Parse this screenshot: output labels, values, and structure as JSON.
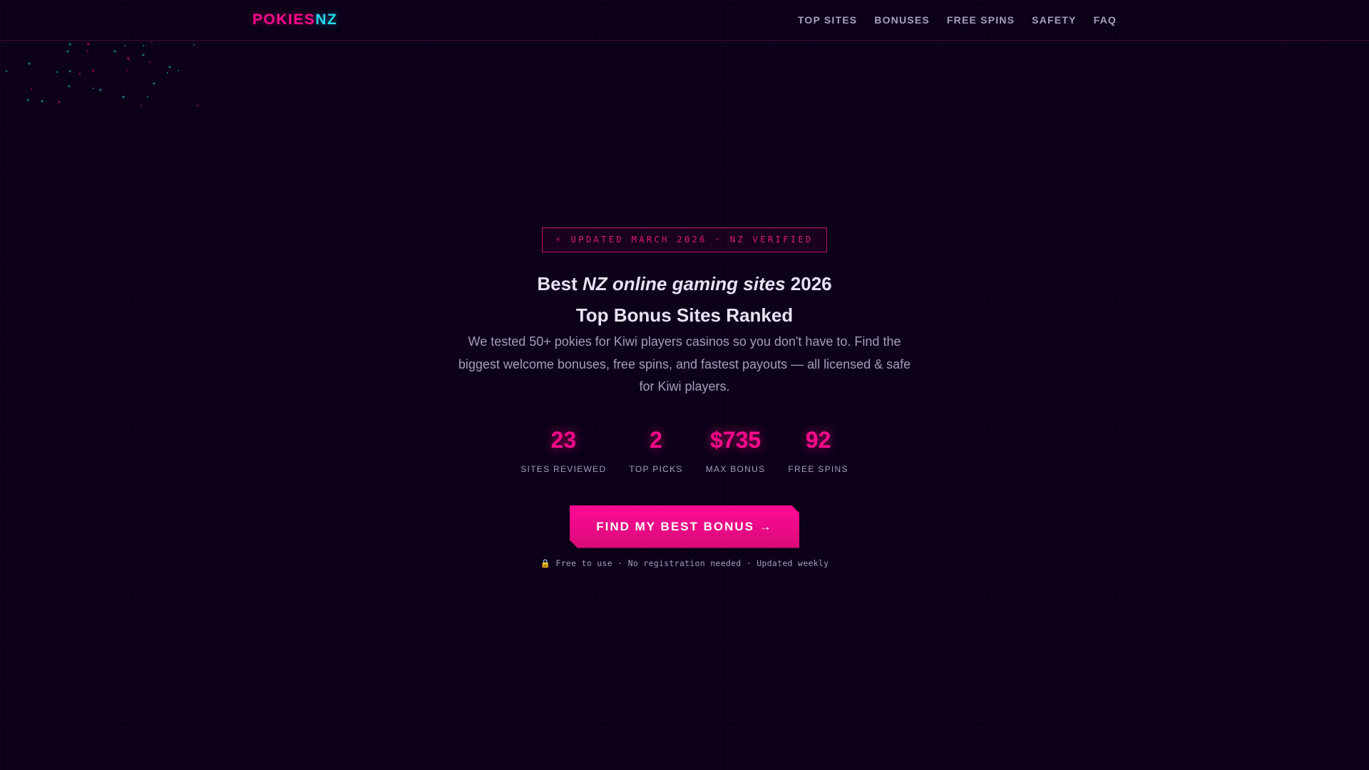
{
  "header": {
    "logo_part1": "POKIES",
    "logo_part2": "NZ",
    "nav": [
      "TOP SITES",
      "BONUSES",
      "FREE SPINS",
      "SAFETY",
      "FAQ"
    ]
  },
  "hero": {
    "badge": "⚡ UPDATED MARCH 2026 · NZ VERIFIED",
    "title_prefix": "Best ",
    "title_emphasis": "NZ online gaming sites",
    "title_suffix": " 2026",
    "subtitle": "Top Bonus Sites Ranked",
    "description": "We tested 50+ pokies for Kiwi players casinos so you don't have to. Find the biggest welcome bonuses, free spins, and fastest payouts — all licensed & safe for Kiwi players.",
    "stats": [
      {
        "value": "23",
        "label": "SITES REVIEWED"
      },
      {
        "value": "2",
        "label": "TOP PICKS"
      },
      {
        "value": "$735",
        "label": "MAX BONUS"
      },
      {
        "value": "92",
        "label": "FREE SPINS"
      }
    ],
    "cta_label": "FIND MY BEST BONUS →",
    "fine_print": "🔒 Free to use · No registration needed · Updated weekly"
  },
  "colors": {
    "background": "#0b0018",
    "accent_pink": "#ff0a8c",
    "accent_cyan": "#27d8ee",
    "text_muted": "#a59db9"
  }
}
